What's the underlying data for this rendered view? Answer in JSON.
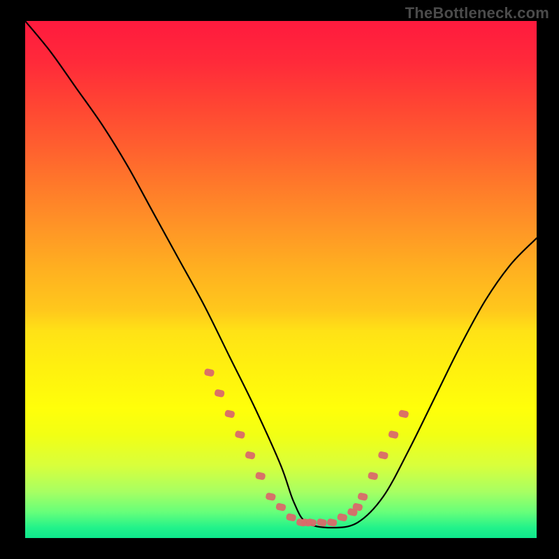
{
  "watermark": "TheBottleneck.com",
  "chart_data": {
    "type": "line",
    "title": "",
    "xlabel": "",
    "ylabel": "",
    "xlim": [
      0,
      100
    ],
    "ylim": [
      0,
      100
    ],
    "series": [
      {
        "name": "curve",
        "x": [
          0,
          5,
          10,
          15,
          20,
          25,
          30,
          35,
          40,
          45,
          50,
          52.5,
          55,
          60,
          65,
          70,
          75,
          80,
          85,
          90,
          95,
          100
        ],
        "values": [
          100,
          94,
          87,
          80,
          72,
          63,
          54,
          45,
          35,
          25,
          14,
          7,
          3,
          2,
          3,
          8,
          17,
          27,
          37,
          46,
          53,
          58
        ]
      }
    ],
    "highlight": {
      "name": "marker-band",
      "x": [
        36,
        38,
        40,
        42,
        44,
        46,
        48,
        50,
        52,
        54,
        55,
        56,
        58,
        60,
        62,
        64,
        65,
        66,
        68,
        70,
        72,
        74
      ],
      "values": [
        32,
        28,
        24,
        20,
        16,
        12,
        8,
        6,
        4,
        3,
        3,
        3,
        3,
        3,
        4,
        5,
        6,
        8,
        12,
        16,
        20,
        24
      ]
    }
  }
}
